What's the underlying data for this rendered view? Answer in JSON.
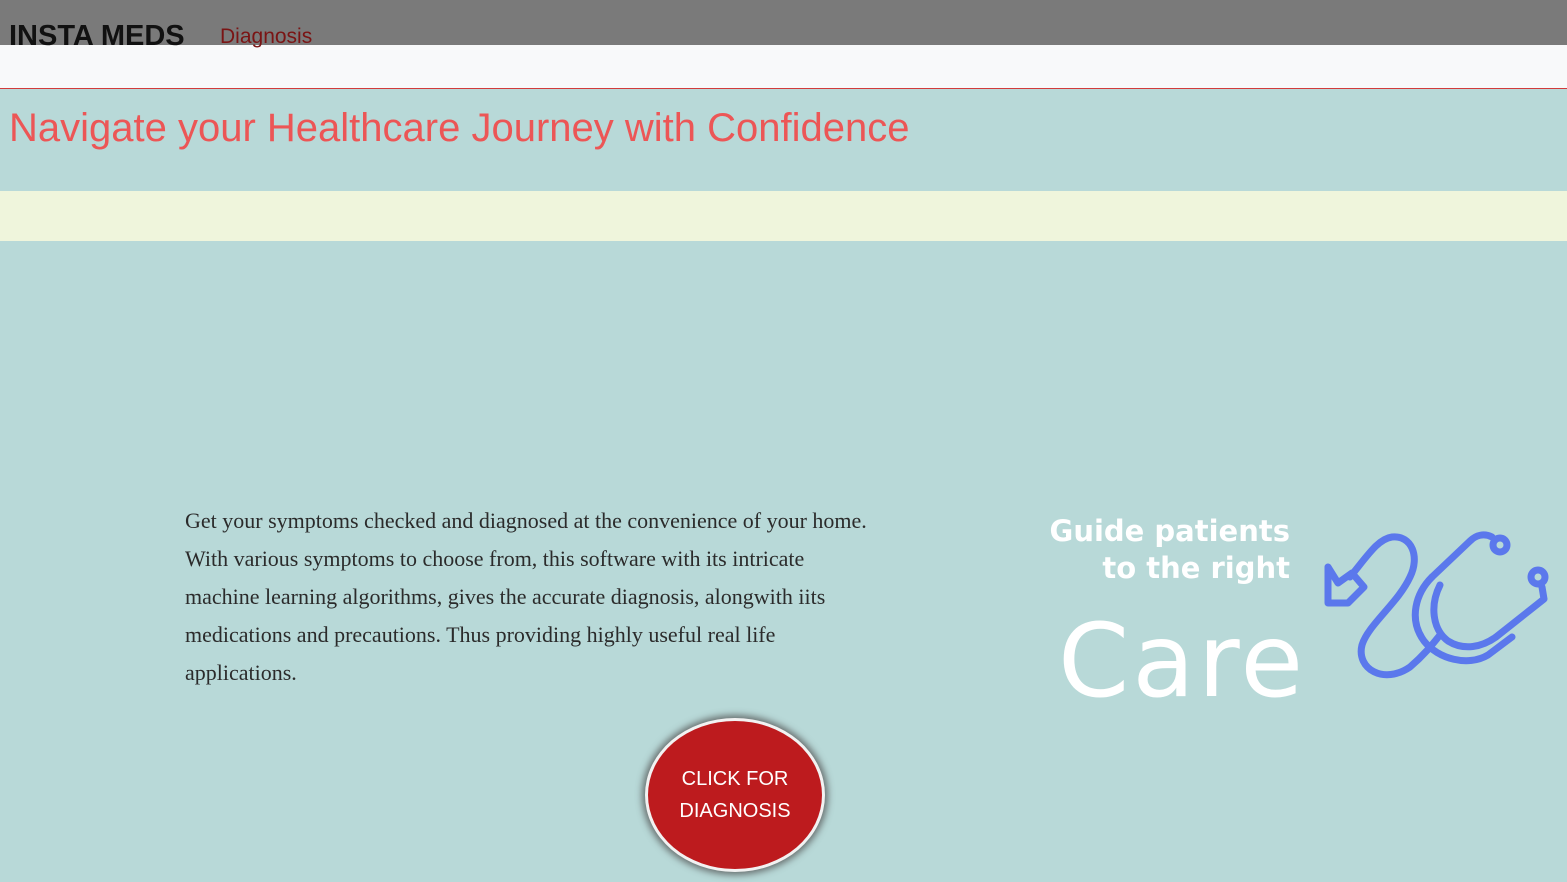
{
  "header": {
    "brand": "INSTA MEDS",
    "nav_link": "Diagnosis"
  },
  "hero": {
    "title": "Navigate your Healthcare Journey with Confidence"
  },
  "main": {
    "description": "Get your symptoms checked and diagnosed at the convenience of your home. With various symptoms to choose from, this software with its intricate machine learning algorithms, gives the accurate diagnosis, alongwith iits medications and precautions. Thus providing highly useful real life applications.",
    "cta_label": "CLICK FOR DIAGNOSIS"
  },
  "promo": {
    "tagline": "Guide patients to the right",
    "headline": "Care",
    "icon": "stethoscope-icon"
  },
  "colors": {
    "topbar": "#7a7a7a",
    "accent": "#ec5656",
    "cta": "#bd1b1e",
    "background": "#b8d9d8",
    "strip": "#eff5dc",
    "icon": "#5b78ec"
  }
}
